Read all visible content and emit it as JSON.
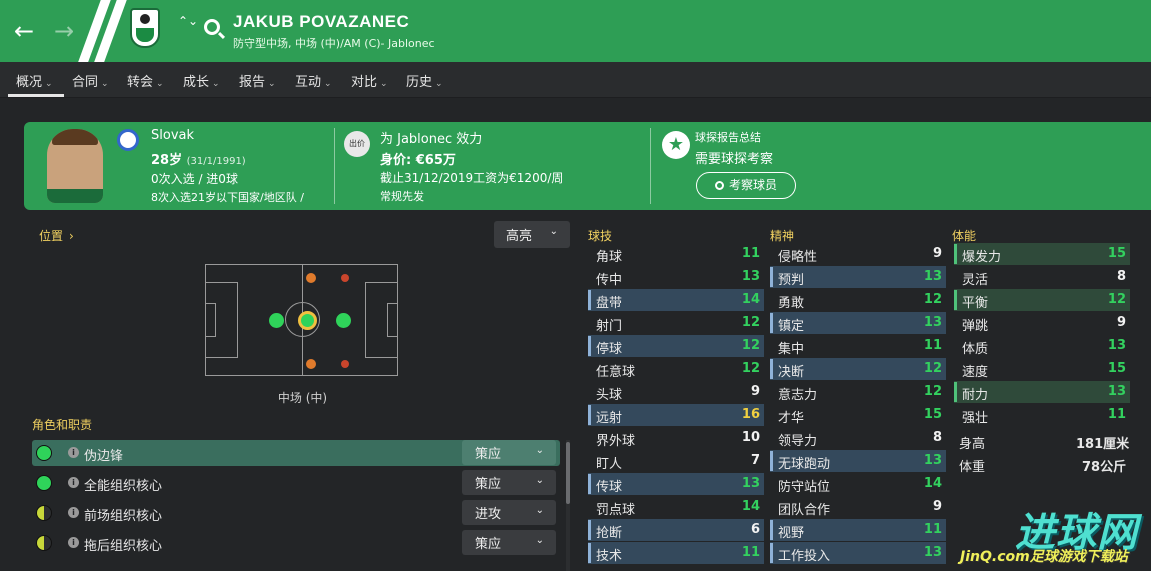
{
  "header": {
    "back_icon": "arrow-left-icon",
    "forward_icon": "arrow-right-icon",
    "updown_glyph": "⌃⌄",
    "player_name": "JAKUB POVAZANEC",
    "subtitle": "防守型中场, 中场 (中)/AM (C)- Jablonec",
    "colors": {
      "brand": "#2e9e55",
      "background": "#232527"
    }
  },
  "tabs": [
    {
      "label": "概况",
      "active": true
    },
    {
      "label": "合同"
    },
    {
      "label": "转会"
    },
    {
      "label": "成长"
    },
    {
      "label": "报告"
    },
    {
      "label": "互动"
    },
    {
      "label": "对比"
    },
    {
      "label": "历史"
    }
  ],
  "info": {
    "nationality": "Slovak",
    "age": "28岁",
    "dob": "(31/1/1991)",
    "caps": "0次入选 / 进0球",
    "youth_caps": "8次入选21岁以下国家/地区队 /",
    "club_badge_text": "出价",
    "club_line": "为 Jablonec 效力",
    "value": "身价: €65万",
    "contract": "截止31/12/2019工资为€1200/周",
    "squad_status": "常规先发",
    "report_title": "球探报告总结",
    "report_text": "需要球探考察",
    "scout_button": "考察球员"
  },
  "position": {
    "label": "位置",
    "highlight_label": "高亮",
    "pitch_caption": "中场 (中)"
  },
  "roles": {
    "title": "角色和职责",
    "items": [
      {
        "name": "伪边锋",
        "duty": "策应",
        "suitability": "full"
      },
      {
        "name": "全能组织核心",
        "duty": "策应",
        "suitability": "full"
      },
      {
        "name": "前场组织核心",
        "duty": "进攻",
        "suitability": "half"
      },
      {
        "name": "拖后组织核心",
        "duty": "策应",
        "suitability": "half"
      }
    ]
  },
  "attributes": {
    "technical_title": "球技",
    "mental_title": "精神",
    "physical_title": "体能",
    "technical": [
      {
        "name": "角球",
        "value": "11",
        "hl": false
      },
      {
        "name": "传中",
        "value": "13",
        "hl": false
      },
      {
        "name": "盘带",
        "value": "14",
        "hl": true
      },
      {
        "name": "射门",
        "value": "12",
        "hl": false
      },
      {
        "name": "停球",
        "value": "12",
        "hl": true
      },
      {
        "name": "任意球",
        "value": "12",
        "hl": false
      },
      {
        "name": "头球",
        "value": "9",
        "hl": false
      },
      {
        "name": "远射",
        "value": "16",
        "hl": true
      },
      {
        "name": "界外球",
        "value": "10",
        "hl": false
      },
      {
        "name": "盯人",
        "value": "7",
        "hl": false
      },
      {
        "name": "传球",
        "value": "13",
        "hl": true
      },
      {
        "name": "罚点球",
        "value": "14",
        "hl": false
      },
      {
        "name": "抢断",
        "value": "6",
        "hl": true
      },
      {
        "name": "技术",
        "value": "11",
        "hl": true
      }
    ],
    "mental": [
      {
        "name": "侵略性",
        "value": "9",
        "hl": false
      },
      {
        "name": "预判",
        "value": "13",
        "hl": true
      },
      {
        "name": "勇敢",
        "value": "12",
        "hl": false
      },
      {
        "name": "镇定",
        "value": "13",
        "hl": true
      },
      {
        "name": "集中",
        "value": "11",
        "hl": false
      },
      {
        "name": "决断",
        "value": "12",
        "hl": true
      },
      {
        "name": "意志力",
        "value": "12",
        "hl": false
      },
      {
        "name": "才华",
        "value": "15",
        "hl": false
      },
      {
        "name": "领导力",
        "value": "8",
        "hl": false
      },
      {
        "name": "无球跑动",
        "value": "13",
        "hl": true
      },
      {
        "name": "防守站位",
        "value": "14",
        "hl": false
      },
      {
        "name": "团队合作",
        "value": "9",
        "hl": false
      },
      {
        "name": "视野",
        "value": "11",
        "hl": true
      },
      {
        "name": "工作投入",
        "value": "13",
        "hl": true
      }
    ],
    "physical": [
      {
        "name": "爆发力",
        "value": "15",
        "hl": true
      },
      {
        "name": "灵活",
        "value": "8",
        "hl": false
      },
      {
        "name": "平衡",
        "value": "12",
        "hl": true
      },
      {
        "name": "弹跳",
        "value": "9",
        "hl": false
      },
      {
        "name": "体质",
        "value": "13",
        "hl": false
      },
      {
        "name": "速度",
        "value": "15",
        "hl": false
      },
      {
        "name": "耐力",
        "value": "13",
        "hl": true
      },
      {
        "name": "强壮",
        "value": "11",
        "hl": false
      }
    ],
    "height_label": "身高",
    "height_value": "181厘米",
    "weight_label": "体重",
    "weight_value": "78公斤"
  },
  "watermark": {
    "big": "进球网",
    "small": "JinQ.com足球游戏下载站"
  }
}
